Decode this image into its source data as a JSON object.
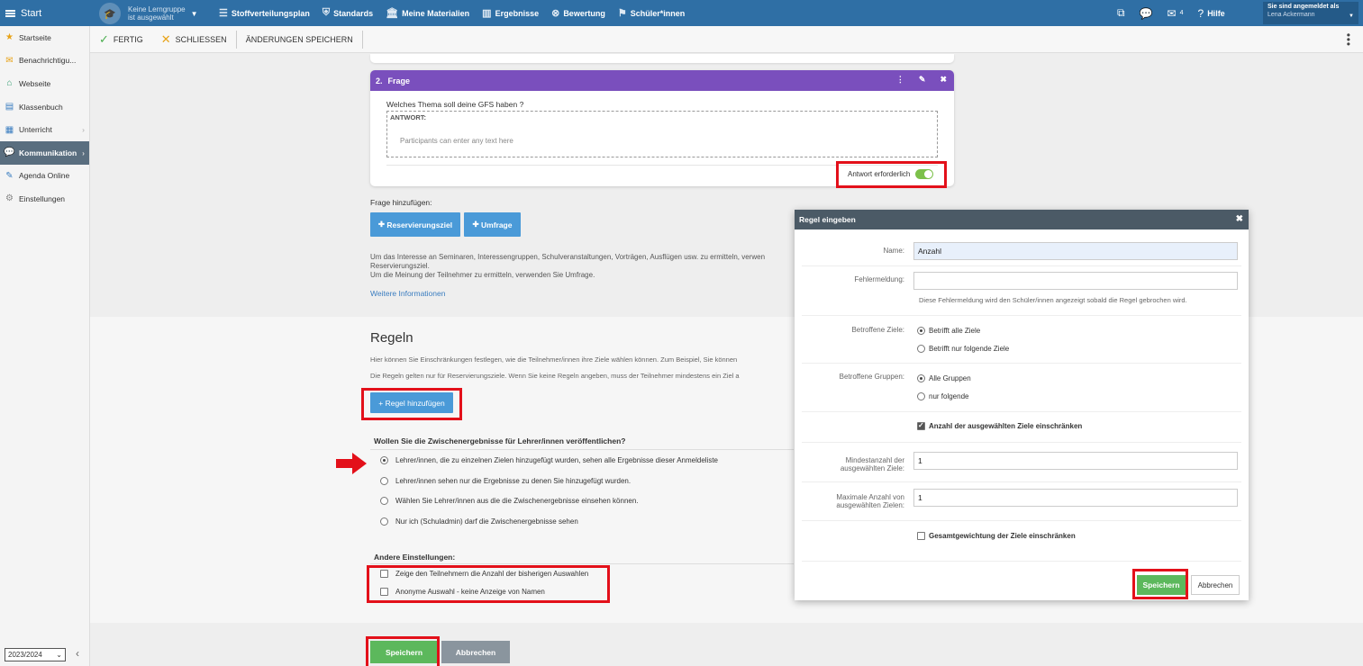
{
  "topbar": {
    "start_label": "Start",
    "group_line1": "Keine Lerngruppe",
    "group_line2": "ist ausgewählt",
    "nav": [
      {
        "label": "Stoffverteilungsplan",
        "icon": "☰"
      },
      {
        "label": "Standards",
        "icon": "⛨"
      },
      {
        "label": "Meine Materialien",
        "icon": "🏛"
      },
      {
        "label": "Ergebnisse",
        "icon": "▥"
      },
      {
        "label": "Bewertung",
        "icon": "⊗"
      },
      {
        "label": "Schüler*innen",
        "icon": "⚑"
      }
    ],
    "mail_count": "4",
    "help_label": "Hilfe",
    "user_line1": "Sie sind angemeldet als",
    "user_line2": "Lena Ackermann"
  },
  "sidebar": {
    "items": [
      {
        "label": "Startseite",
        "icon": "★",
        "color": "#e8a317"
      },
      {
        "label": "Benachrichtigu...",
        "icon": "✉",
        "color": "#e8a317"
      },
      {
        "label": "Webseite",
        "icon": "⌂",
        "color": "#2e9b6e"
      },
      {
        "label": "Klassenbuch",
        "icon": "▤",
        "color": "#3a7dc0"
      },
      {
        "label": "Unterricht",
        "icon": "▦",
        "color": "#3a7dc0"
      },
      {
        "label": "Kommunikation",
        "icon": "💬",
        "color": "#ffffff"
      },
      {
        "label": "Agenda Online",
        "icon": "✎",
        "color": "#3a7dc0"
      },
      {
        "label": "Einstellungen",
        "icon": "⚙",
        "color": "#888888"
      }
    ],
    "year": "2023/2024"
  },
  "toolbar": {
    "done_label": "FERTIG",
    "close_label": "SCHLIESSEN",
    "save_changes_label": "ÄNDERUNGEN SPEICHERN"
  },
  "question": {
    "number": "2.",
    "title": "Frage",
    "text": "Welches Thema soll deine GFS haben ?",
    "answer_label": "ANTWORT:",
    "answer_placeholder": "Participants can enter any text here",
    "required_label": "Antwort erforderlich"
  },
  "add_question": {
    "label": "Frage hinzufügen:",
    "reservation_btn": "Reservierungsziel",
    "survey_btn": "Umfrage",
    "info_line1": "Um das Interesse an Seminaren, Interessengruppen, Schulveranstaltungen, Vorträgen, Ausflügen usw. zu ermitteln, verwen",
    "info_line2": "Reservierungsziel.",
    "info_line3": "Um die Meinung der Teilnehmer zu ermitteln, verwenden Sie Umfrage.",
    "more_link": "Weitere Informationen"
  },
  "rules": {
    "title": "Regeln",
    "text1": "Hier können Sie Einschränkungen festlegen, wie die Teilnehmer/innen ihre Ziele wählen können. Zum Beispiel, Sie können",
    "text2": "Die Regeln gelten nur für Reservierungsziele. Wenn Sie keine Regeln angeben, muss der Teilnehmer mindestens ein Ziel a",
    "add_btn": "+ Regel hinzufügen"
  },
  "publish": {
    "question": "Wollen Sie die Zwischenergebnisse für Lehrer/innen veröffentlichen?",
    "options": [
      "Lehrer/innen, die zu einzelnen Zielen hinzugefügt wurden, sehen alle Ergebnisse dieser Anmeldeliste",
      "Lehrer/innen sehen nur die Ergebnisse zu denen Sie hinzugefügt wurden.",
      "Wählen Sie Lehrer/innen aus die die Zwischenergebnisse einsehen können.",
      "Nur ich (Schuladmin) darf die Zwischenergebnisse sehen"
    ]
  },
  "other": {
    "title": "Andere Einstellungen:",
    "options": [
      "Zeige den Teilnehmern die Anzahl der bisherigen Auswahlen",
      "Anonyme Auswahl - keine Anzeige von Namen"
    ]
  },
  "footer": {
    "save_btn": "Speichern",
    "cancel_btn": "Abbrechen"
  },
  "modal": {
    "title": "Regel eingeben",
    "name_label": "Name:",
    "name_value": "Anzahl",
    "error_label": "Fehlermeldung:",
    "error_value": "",
    "error_hint": "Diese Fehlermeldung wird den Schüler/innen angezeigt sobald die Regel gebrochen wird.",
    "targets_label": "Betroffene Ziele:",
    "targets_all": "Betrifft alle Ziele",
    "targets_some": "Betrifft nur folgende Ziele",
    "groups_label": "Betroffene Gruppen:",
    "groups_all": "Alle Gruppen",
    "groups_some": "nur folgende",
    "limit_count_label": "Anzahl der ausgewählten Ziele einschränken",
    "min_label_1": "Mindestanzahl der",
    "min_label_2": "ausgewählten Ziele:",
    "min_value": "1",
    "max_label_1": "Maximale Anzahl von",
    "max_label_2": "ausgewählten Zielen:",
    "max_value": "1",
    "weight_label": "Gesamtgewichtung der Ziele einschränken",
    "save_btn": "Speichern",
    "cancel_btn": "Abbrechen"
  },
  "colors": {
    "topbar": "#2f6fa5",
    "question_header": "#7a4fbd",
    "primary_button": "#4a9ad8",
    "save_button": "#5cb85c",
    "highlight": "#e3101a"
  }
}
